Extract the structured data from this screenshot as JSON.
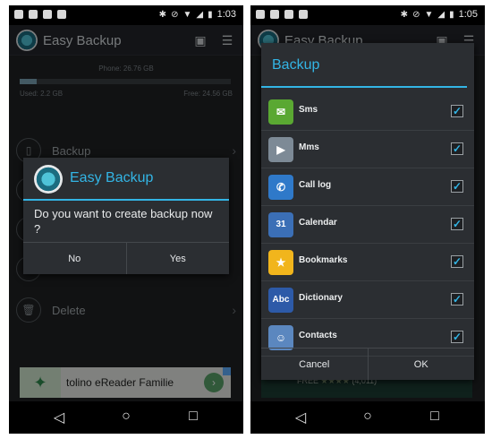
{
  "left_screen": {
    "status": {
      "time": "1:03"
    },
    "app": {
      "title": "Easy Backup"
    },
    "storage": {
      "phone_label": "Phone: 26.76 GB",
      "used_label": "Used: 2.2 GB",
      "free_label": "Free: 24.56 GB",
      "used_fraction": 0.08
    },
    "menu": [
      {
        "label": "Backup",
        "icon": "phone-backup-icon"
      },
      {
        "label": "Delete",
        "icon": "trash-icon"
      }
    ],
    "dialog": {
      "title": "Easy Backup",
      "message": "Do you want to create backup now ?",
      "no_label": "No",
      "yes_label": "Yes"
    },
    "ad": {
      "text": "tolino eReader Familie"
    }
  },
  "right_screen": {
    "status": {
      "time": "1:05"
    },
    "app": {
      "title": "Easy Backup"
    },
    "dialog": {
      "title": "Backup",
      "items": [
        {
          "label": "Sms",
          "icon": "sms-icon",
          "color": "#5aa832",
          "checked": true
        },
        {
          "label": "Mms",
          "icon": "mms-icon",
          "color": "#7d8a96",
          "checked": true
        },
        {
          "label": "Call log",
          "icon": "call-log-icon",
          "color": "#2f79c9",
          "checked": true
        },
        {
          "label": "Calendar",
          "icon": "calendar-icon",
          "color": "#3b6fb6",
          "checked": true
        },
        {
          "label": "Bookmarks",
          "icon": "bookmarks-icon",
          "color": "#f1b51c",
          "checked": true
        },
        {
          "label": "Dictionary",
          "icon": "dictionary-icon",
          "color": "#2d5aa8",
          "checked": true
        },
        {
          "label": "Contacts",
          "icon": "contacts-icon",
          "color": "#5b87bf",
          "checked": true
        }
      ],
      "cancel_label": "Cancel",
      "ok_label": "OK"
    },
    "ad": {
      "free_label": "FREE",
      "stars": "★★★★",
      "rating_count": "(4,011)"
    }
  },
  "colors": {
    "accent": "#33b5e5",
    "dialog_bg": "#2b2e32",
    "app_bg": "#1f2124"
  }
}
